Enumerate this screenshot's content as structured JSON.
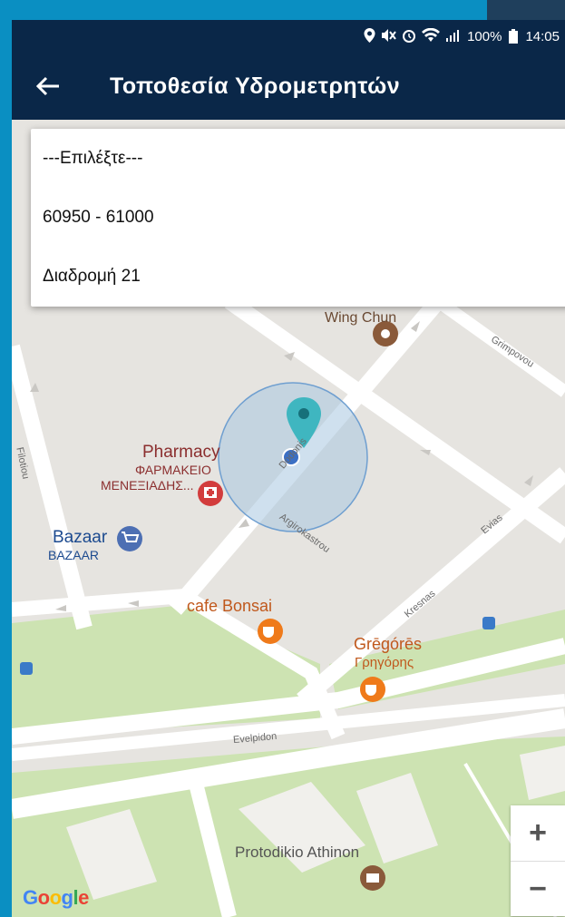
{
  "status": {
    "battery": "100%",
    "time": "14:05"
  },
  "appbar": {
    "title": "Τοποθεσία Υδρομετρητών"
  },
  "dropdown": {
    "options": [
      "---Επιλέξτε---",
      "60950 - 61000",
      "Διαδρομή 21"
    ]
  },
  "map": {
    "pois": {
      "wing_chun": "Wing Chun",
      "pharmacy_en": "Pharmacy",
      "pharmacy_gr1": "ΦΑΡΜΑΚΕΙΟ",
      "pharmacy_gr2": "ΜΕΝΕΞΙΑΔΗΣ...",
      "bazaar_en": "Bazaar",
      "bazaar_gr": "BAZAAR",
      "cafe_bonsai": "cafe Bonsai",
      "gregores_en": "Grēgórēs",
      "gregores_gr": "Γρηγόρης",
      "protodikio": "Protodikio Athinon"
    },
    "streets": {
      "grimpovou": "Grimpovou",
      "filotiou": "Filotiou",
      "dodonis": "Dodonis",
      "argirokastrou": "Argirokastrou",
      "evias": "Evias",
      "kresnas": "Kresnas",
      "evelpidon": "Evelpidon"
    },
    "zoom_in": "+",
    "zoom_out": "−",
    "attribution": "Google"
  },
  "colors": {
    "appbar": "#0a2748",
    "marker": "#3fb6c0",
    "location_dot": "#3b6fc4"
  }
}
